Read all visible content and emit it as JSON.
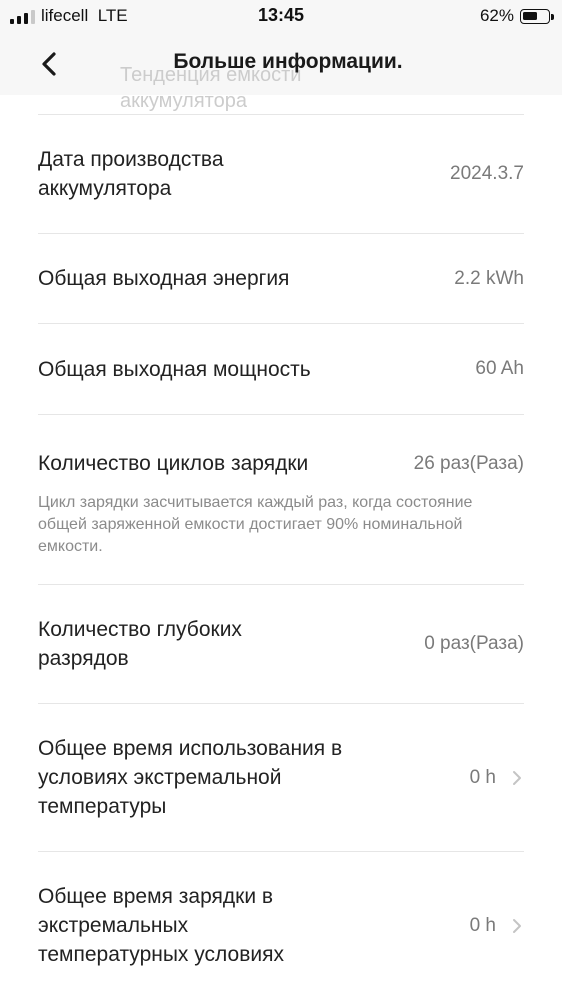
{
  "status_bar": {
    "carrier": "lifecell",
    "network": "LTE",
    "time": "13:45",
    "battery_percent_label": "62%",
    "battery_level": 0.62
  },
  "ghost_behind_header": [
    "Тенденция емкости",
    "аккумулятора"
  ],
  "nav": {
    "title": "Больше информации."
  },
  "rows": [
    {
      "label": "Дата производства аккумулятора",
      "value": "2024.3.7"
    },
    {
      "label": "Общая выходная энергия",
      "value": "2.2 kWh"
    },
    {
      "label": "Общая выходная мощность",
      "value": "60 Ah"
    },
    {
      "label": "Количество циклов зарядки",
      "value": "26 раз(Раза)",
      "note": "Цикл зарядки засчитывается каждый раз, когда состояние общей заряженной емкости достигает 90% номинальной емкости."
    },
    {
      "label": "Количество глубоких разрядов",
      "value": "0 раз(Раза)"
    },
    {
      "label": "Общее время использования в условиях экстремальной температуры",
      "value": "0 h"
    },
    {
      "label": "Общее время зарядки в экстремальных температурных условиях",
      "value": "0 h"
    }
  ],
  "icons": {
    "back": "chevron-left-icon",
    "row_arrow": "chevron-right-icon"
  },
  "colors": {
    "header_bg": "#f7f7f7",
    "divider": "#e6e6e6",
    "value_text": "#7a7a7a",
    "note_text": "#8b8b8b"
  }
}
